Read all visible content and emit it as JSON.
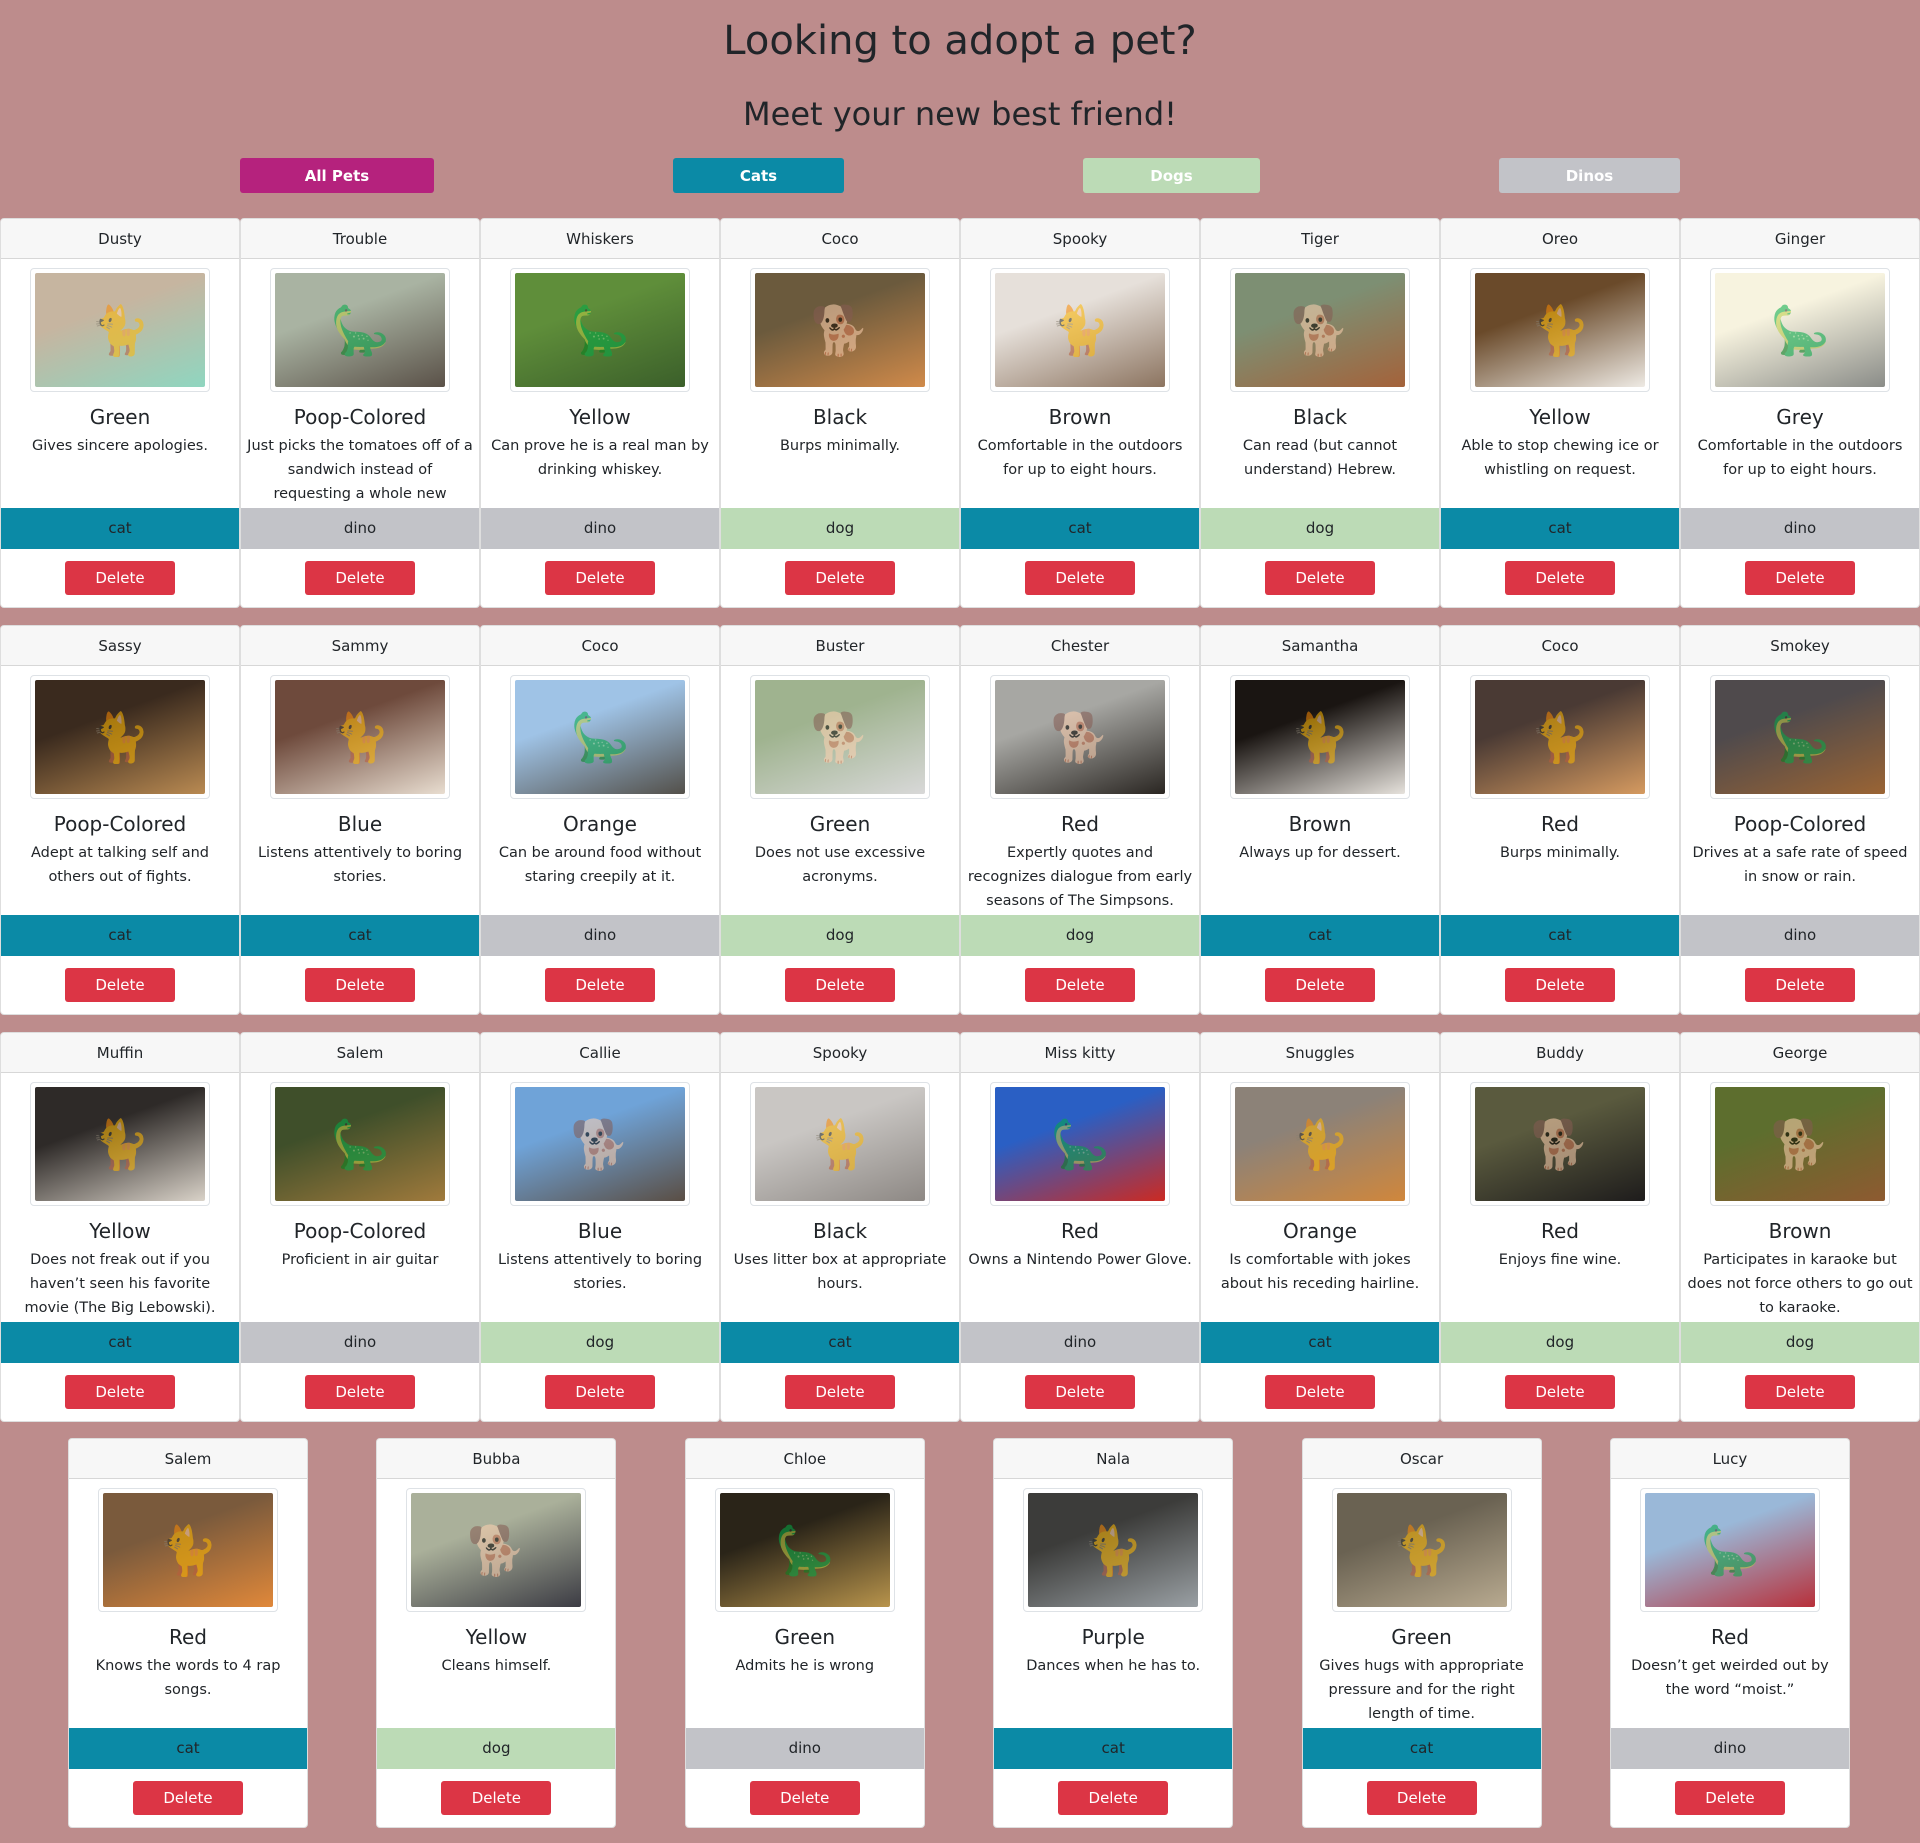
{
  "header": {
    "title": "Looking to adopt a pet?",
    "subtitle": "Meet your new best friend!"
  },
  "filters": {
    "all": "All Pets",
    "cats": "Cats",
    "dogs": "Dogs",
    "dinos": "Dinos"
  },
  "colors": {
    "background": "#bd8c8c",
    "all_button": "#b5227d",
    "cat": "#0b8aa6",
    "dog": "#bcdbb6",
    "dino": "#c2c3c8",
    "delete": "#dc3545"
  },
  "delete_label": "Delete",
  "pets": [
    {
      "name": "Dusty",
      "color": "Green",
      "trait": "Gives sincere apologies.",
      "type": "cat",
      "photo": [
        "#c6b5a0",
        "#8fd6c0"
      ],
      "icon": "cat-photo-icon"
    },
    {
      "name": "Trouble",
      "color": "Poop-Colored",
      "trait": "Just picks the tomatoes off of a sandwich instead of requesting a whole new sandwich.",
      "type": "dino",
      "photo": [
        "#a9b3a2",
        "#5a5148"
      ],
      "icon": "dinosaur-photo-icon"
    },
    {
      "name": "Whiskers",
      "color": "Yellow",
      "trait": "Can prove he is a real man by drinking whiskey.",
      "type": "dino",
      "photo": [
        "#5f8e3a",
        "#3b5f2a"
      ],
      "icon": "dinosaur-photo-icon"
    },
    {
      "name": "Coco",
      "color": "Black",
      "trait": "Burps minimally.",
      "type": "dog",
      "photo": [
        "#6b5a3d",
        "#d08a4a"
      ],
      "icon": "dog-photo-icon"
    },
    {
      "name": "Spooky",
      "color": "Brown",
      "trait": "Comfortable in the outdoors for up to eight hours.",
      "type": "cat",
      "photo": [
        "#e6e0da",
        "#8c7460"
      ],
      "icon": "cat-photo-icon"
    },
    {
      "name": "Tiger",
      "color": "Black",
      "trait": "Can read (but cannot understand) Hebrew.",
      "type": "dog",
      "photo": [
        "#7d8f73",
        "#a4623a"
      ],
      "icon": "dog-photo-icon"
    },
    {
      "name": "Oreo",
      "color": "Yellow",
      "trait": "Able to stop chewing ice or whistling on request.",
      "type": "cat",
      "photo": [
        "#6a4a2a",
        "#eeeae4"
      ],
      "icon": "cat-photo-icon"
    },
    {
      "name": "Ginger",
      "color": "Grey",
      "trait": "Comfortable in the outdoors for up to eight hours.",
      "type": "dino",
      "photo": [
        "#f7f3df",
        "#8a8c88"
      ],
      "icon": "dinosaur-photo-icon"
    },
    {
      "name": "Sassy",
      "color": "Poop-Colored",
      "trait": "Adept at talking self and others out of fights.",
      "type": "cat",
      "photo": [
        "#3a2a1e",
        "#b98a52"
      ],
      "icon": "cat-photo-icon"
    },
    {
      "name": "Sammy",
      "color": "Blue",
      "trait": "Listens attentively to boring stories.",
      "type": "cat",
      "photo": [
        "#6e4a3c",
        "#e8ddd0"
      ],
      "icon": "cat-photo-icon"
    },
    {
      "name": "Coco",
      "color": "Orange",
      "trait": "Can be around food without staring creepily at it.",
      "type": "dino",
      "photo": [
        "#9fc3e6",
        "#53504a"
      ],
      "icon": "dinosaur-photo-icon"
    },
    {
      "name": "Buster",
      "color": "Green",
      "trait": "Does not use excessive acronyms.",
      "type": "dog",
      "photo": [
        "#9fb38f",
        "#d8d8d8"
      ],
      "icon": "dog-photo-icon"
    },
    {
      "name": "Chester",
      "color": "Red",
      "trait": "Expertly quotes and recognizes dialogue from early seasons of The Simpsons.",
      "type": "dog",
      "photo": [
        "#a7a7a3",
        "#2a2622"
      ],
      "icon": "dog-photo-icon"
    },
    {
      "name": "Samantha",
      "color": "Brown",
      "trait": "Always up for dessert.",
      "type": "cat",
      "photo": [
        "#1a1512",
        "#e6e2dc"
      ],
      "icon": "cat-photo-icon"
    },
    {
      "name": "Coco",
      "color": "Red",
      "trait": "Burps minimally.",
      "type": "cat",
      "photo": [
        "#4a3a34",
        "#d59a60"
      ],
      "icon": "cat-photo-icon"
    },
    {
      "name": "Smokey",
      "color": "Poop-Colored",
      "trait": "Drives at a safe rate of speed in snow or rain.",
      "type": "dino",
      "photo": [
        "#4f4a4c",
        "#9a6434"
      ],
      "icon": "dinosaur-photo-icon"
    },
    {
      "name": "Muffin",
      "color": "Yellow",
      "trait": "Does not freak out if you haven’t seen his favorite movie (The Big Lebowski).",
      "type": "cat",
      "photo": [
        "#2e2a28",
        "#d9d2c8"
      ],
      "icon": "cat-photo-icon"
    },
    {
      "name": "Salem",
      "color": "Poop-Colored",
      "trait": "Proficient in air guitar",
      "type": "dino",
      "photo": [
        "#3f4f2a",
        "#a07a3c"
      ],
      "icon": "dinosaur-photo-icon"
    },
    {
      "name": "Callie",
      "color": "Blue",
      "trait": "Listens attentively to boring stories.",
      "type": "dog",
      "photo": [
        "#6fa3d8",
        "#5a4e44"
      ],
      "icon": "dog-photo-icon"
    },
    {
      "name": "Spooky",
      "color": "Black",
      "trait": "Uses litter box at appropriate hours.",
      "type": "cat",
      "photo": [
        "#c9c6c3",
        "#8d8884"
      ],
      "icon": "cat-photo-icon"
    },
    {
      "name": "Miss kitty",
      "color": "Red",
      "trait": "Owns a Nintendo Power Glove.",
      "type": "dino",
      "photo": [
        "#2a5fc4",
        "#cc2a22"
      ],
      "icon": "dinosaur-photo-icon"
    },
    {
      "name": "Snuggles",
      "color": "Orange",
      "trait": "Is comfortable with jokes about his receding hairline.",
      "type": "cat",
      "photo": [
        "#8c8278",
        "#d0873c"
      ],
      "icon": "cat-photo-icon"
    },
    {
      "name": "Buddy",
      "color": "Red",
      "trait": "Enjoys fine wine.",
      "type": "dog",
      "photo": [
        "#5a5a3e",
        "#1e1c1c"
      ],
      "icon": "dog-photo-icon"
    },
    {
      "name": "George",
      "color": "Brown",
      "trait": "Participates in karaoke but does not force others to go out to karaoke.",
      "type": "dog",
      "photo": [
        "#5d6e2e",
        "#8e5a30"
      ],
      "icon": "dog-photo-icon"
    },
    {
      "name": "Salem",
      "color": "Red",
      "trait": "Knows the words to 4 rap songs.",
      "type": "cat",
      "photo": [
        "#7a5a3c",
        "#e0883a"
      ],
      "icon": "cat-photo-icon"
    },
    {
      "name": "Bubba",
      "color": "Yellow",
      "trait": "Cleans himself.",
      "type": "dog",
      "photo": [
        "#aab09a",
        "#3c3c44"
      ],
      "icon": "dog-photo-icon"
    },
    {
      "name": "Chloe",
      "color": "Green",
      "trait": "Admits he is wrong",
      "type": "dino",
      "photo": [
        "#2a2418",
        "#b8944c"
      ],
      "icon": "dinosaur-photo-icon"
    },
    {
      "name": "Nala",
      "color": "Purple",
      "trait": "Dances when he has to.",
      "type": "cat",
      "photo": [
        "#3c3c3a",
        "#9aa0a4"
      ],
      "icon": "cat-photo-icon"
    },
    {
      "name": "Oscar",
      "color": "Green",
      "trait": "Gives hugs with appropriate pressure and for the right length of time.",
      "type": "cat",
      "photo": [
        "#6a6252",
        "#b8aa90"
      ],
      "icon": "cat-photo-icon"
    },
    {
      "name": "Lucy",
      "color": "Red",
      "trait": "Doesn’t get weirded out by the word “moist.”",
      "type": "dino",
      "photo": [
        "#9ab8d8",
        "#b8303a"
      ],
      "icon": "dinosaur-photo-icon"
    }
  ]
}
